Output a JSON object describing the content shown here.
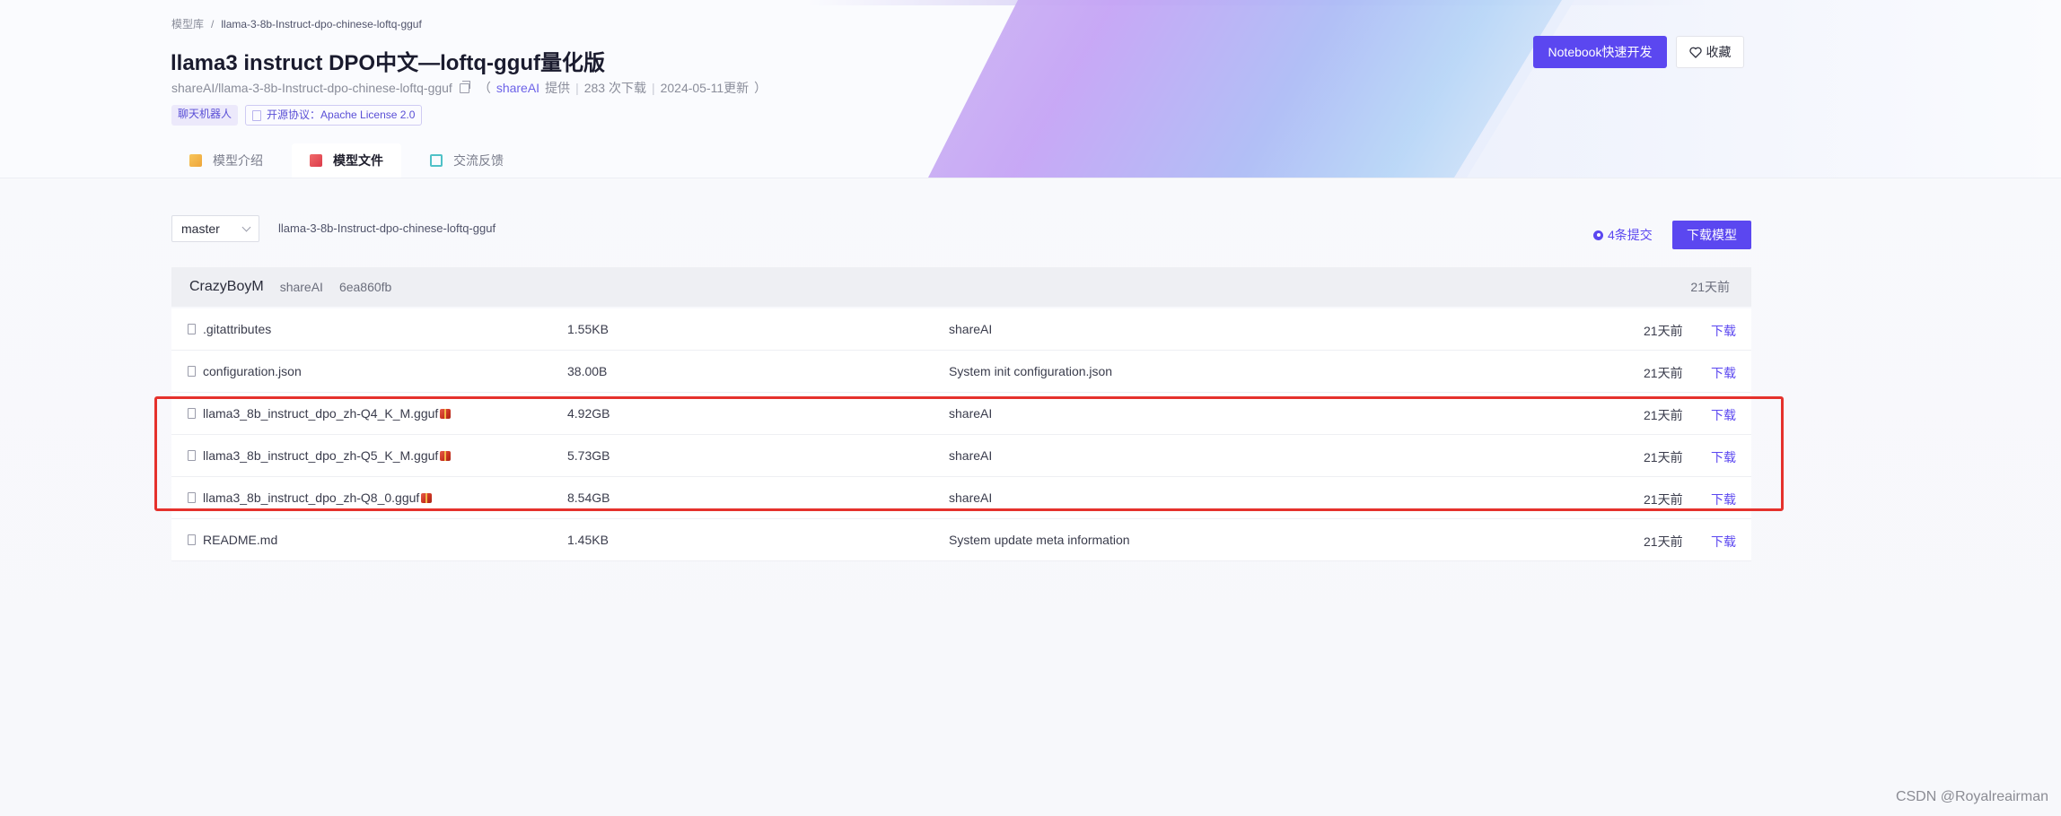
{
  "breadcrumb": {
    "root": "模型库",
    "separator": "/",
    "current": "llama-3-8b-Instruct-dpo-chinese-loftq-gguf"
  },
  "model": {
    "title": "llama3 instruct DPO中文—loftq-gguf量化版",
    "repo_id": "shareAI/llama-3-8b-Instruct-dpo-chinese-loftq-gguf",
    "provider_open": "（",
    "provider": "shareAI",
    "provided_suffix": "提供",
    "downloads": "283 次下载",
    "updated": "2024-05-11更新",
    "close_paren": "）",
    "meta_sep": "|"
  },
  "tags": {
    "category": "聊天机器人",
    "license": "开源协议：Apache License 2.0"
  },
  "actions": {
    "notebook": "Notebook快速开发",
    "collect": "收藏"
  },
  "tabs": [
    {
      "label": "模型介绍",
      "icon": "box-icon"
    },
    {
      "label": "模型文件",
      "icon": "book-icon",
      "active": true
    },
    {
      "label": "交流反馈",
      "icon": "edit-icon"
    }
  ],
  "repo": {
    "branch": "master",
    "path": "llama-3-8b-Instruct-dpo-chinese-loftq-gguf",
    "commits": "4条提交",
    "download_button": "下载模型"
  },
  "last_commit": {
    "author": "CrazyBoyM",
    "user": "shareAI",
    "hash": "6ea860fb",
    "time": "21天前"
  },
  "files": [
    {
      "name": ".gitattributes",
      "size": "1.55KB",
      "message": "shareAI",
      "time": "21天前",
      "action": "下载",
      "lfs": false
    },
    {
      "name": "configuration.json",
      "size": "38.00B",
      "message": "System init configuration.json",
      "time": "21天前",
      "action": "下载",
      "lfs": false
    },
    {
      "name": "llama3_8b_instruct_dpo_zh-Q4_K_M.gguf",
      "size": "4.92GB",
      "message": "shareAI",
      "time": "21天前",
      "action": "下载",
      "lfs": true
    },
    {
      "name": "llama3_8b_instruct_dpo_zh-Q5_K_M.gguf",
      "size": "5.73GB",
      "message": "shareAI",
      "time": "21天前",
      "action": "下载",
      "lfs": true
    },
    {
      "name": "llama3_8b_instruct_dpo_zh-Q8_0.gguf",
      "size": "8.54GB",
      "message": "shareAI",
      "time": "21天前",
      "action": "下载",
      "lfs": true
    },
    {
      "name": "README.md",
      "size": "1.45KB",
      "message": "System update meta information",
      "time": "21天前",
      "action": "下载",
      "lfs": false
    }
  ],
  "watermark": "CSDN @Royalreairman",
  "colors": {
    "accent": "#5b47f0",
    "highlight": "#e5312c"
  }
}
